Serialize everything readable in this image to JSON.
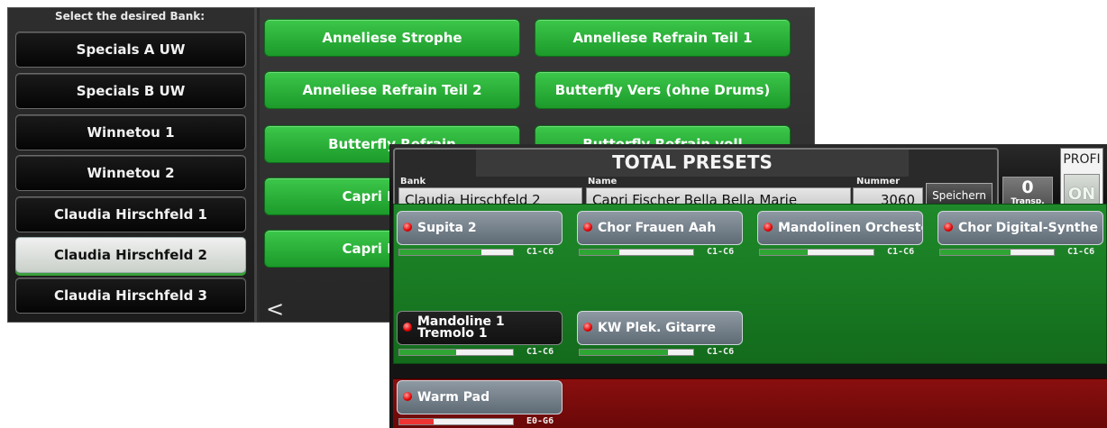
{
  "bank_panel": {
    "header": "Select the desired Bank:",
    "banks": [
      {
        "label": "Specials A UW",
        "selected": false
      },
      {
        "label": "Specials B UW",
        "selected": false
      },
      {
        "label": "Winnetou 1",
        "selected": false
      },
      {
        "label": "Winnetou 2",
        "selected": false
      },
      {
        "label": "Claudia Hirschfeld 1",
        "selected": false
      },
      {
        "label": "Claudia Hirschfeld 2",
        "selected": true
      },
      {
        "label": "Claudia Hirschfeld 3",
        "selected": false
      }
    ],
    "presets": [
      "Anneliese Strophe",
      "Anneliese Refrain Teil 1",
      "Anneliese Refrain Teil 2",
      "Butterfly Vers (ohne Drums)",
      "Butterfly Refrain",
      "Butterfly Refrain voll",
      "Capri Fischer",
      "",
      "Capri Fischer",
      ""
    ],
    "back_arrow": "<",
    "colors": {
      "preset_green": "#2db33c",
      "panel": "#2b2b2b"
    }
  },
  "total_presets": {
    "title": "TOTAL PRESETS",
    "bank_label": "Bank",
    "bank_value": "Claudia Hirschfeld 2",
    "name_label": "Name",
    "name_value": "Capri Fischer Bella Bella Marie",
    "number_label": "Nummer",
    "number_value": "3060",
    "save_label": "Speichern",
    "transpose_value": "0",
    "transpose_label": "Transp.",
    "profi_label": "PROFI",
    "profi_state": "ON",
    "upper_voices": [
      {
        "name": "Supita 2",
        "range": "C1-C6",
        "volume": 0.72,
        "style": "normal"
      },
      {
        "name": "Chor Frauen Aah",
        "range": "C1-C6",
        "volume": 0.35,
        "style": "normal"
      },
      {
        "name": "Mandolinen Orchester",
        "range": "C1-C6",
        "volume": 0.42,
        "style": "normal"
      },
      {
        "name": "Chor Digital-Synthe",
        "range": "C1-C6",
        "volume": 0.62,
        "style": "normal"
      },
      {
        "name": "Mandoline 1 Tremolo 1",
        "range": "C1-C6",
        "volume": 0.5,
        "style": "dark"
      },
      {
        "name": "KW Plek. Gitarre",
        "range": "C1-C6",
        "volume": 0.78,
        "style": "normal"
      }
    ],
    "lower_voices": [
      {
        "name": "Warm Pad",
        "range": "E0-G6",
        "volume": 0.3,
        "style": "normal"
      }
    ],
    "colors": {
      "upper_zone": "#1f8a2a",
      "lower_zone": "#8a0f0f",
      "led": "#e10000"
    }
  }
}
